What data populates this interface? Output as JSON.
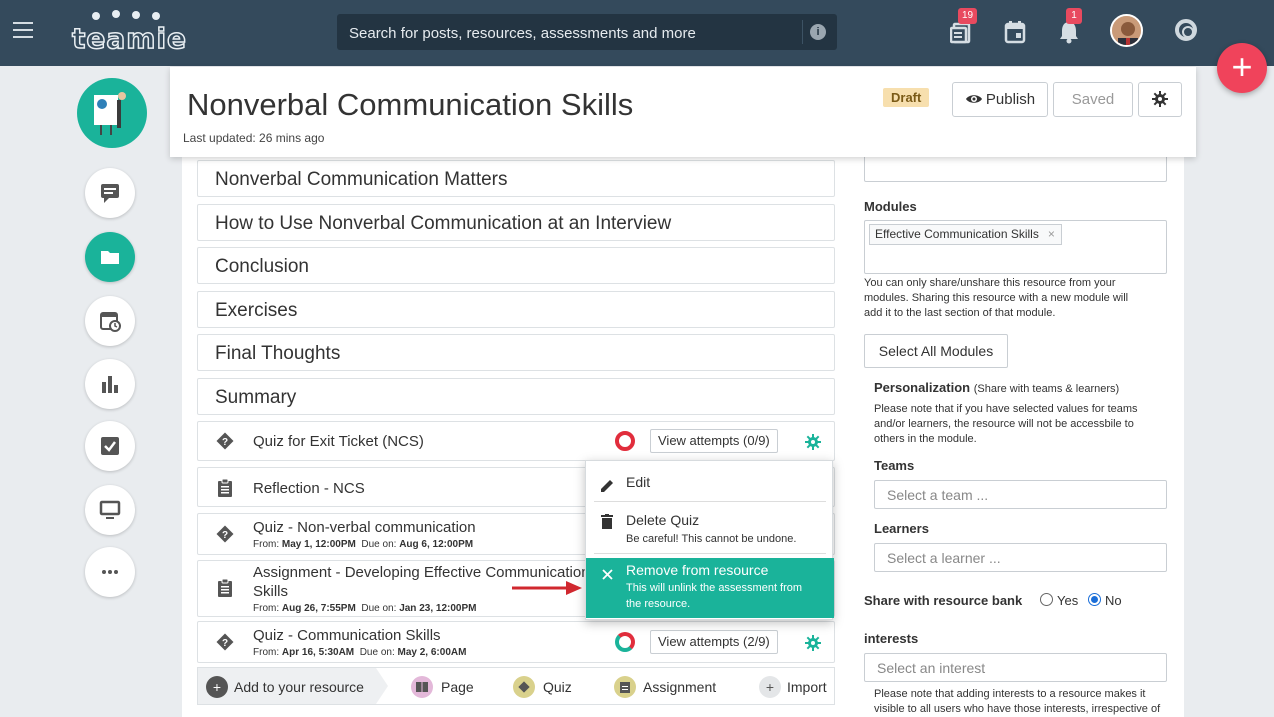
{
  "app": {
    "logo_text": "teamie",
    "search_placeholder": "Search for posts, resources, assessments and more",
    "search_info": "i",
    "badges": {
      "resources": "19",
      "notifications": "1"
    },
    "fab_label": "+"
  },
  "header": {
    "title": "Nonverbal Communication Skills",
    "last_updated": "Last updated: 26 mins ago",
    "status": "Draft",
    "publish_label": "Publish",
    "saved_label": "Saved"
  },
  "sections": [
    "Nonverbal Communication Matters",
    "How to Use Nonverbal Communication at an Interview",
    "Conclusion",
    "Exercises",
    "Final Thoughts",
    "Summary"
  ],
  "items": [
    {
      "type": "quiz",
      "name": "Quiz for Exit Ticket (NCS)",
      "attempts": "View attempts (0/9)"
    },
    {
      "type": "assignment",
      "name": "Reflection - NCS"
    },
    {
      "type": "quiz",
      "name": "Quiz - Non-verbal communication",
      "from_label": "From:",
      "from": "May 1, 12:00PM",
      "due_label": "Due on:",
      "due": "Aug 6, 12:00PM"
    },
    {
      "type": "assignment",
      "name_line1": "Assignment - Developing Effective Communication",
      "name_line2": "Skills",
      "from_label": "From:",
      "from": "Aug 26, 7:55PM",
      "due_label": "Due on:",
      "due": "Jan 23, 12:00PM"
    },
    {
      "type": "quiz",
      "name": "Quiz - Communication Skills",
      "from_label": "From:",
      "from": "Apr 16, 5:30AM",
      "due_label": "Due on:",
      "due": "May 2, 6:00AM",
      "attempts": "View attempts (2/9)"
    }
  ],
  "add_bar": {
    "add_label": "Add to your resource",
    "page": "Page",
    "quiz": "Quiz",
    "assignment": "Assignment",
    "import": "Import"
  },
  "menu": {
    "edit": "Edit",
    "delete": "Delete Quiz",
    "delete_sub": "Be careful! This cannot be undone.",
    "remove": "Remove from resource",
    "remove_sub_1": "This will unlink the assessment from",
    "remove_sub_2": "the resource."
  },
  "right": {
    "modules_label": "Modules",
    "module_chip": "Effective Communication Skills",
    "chip_remove": "×",
    "modules_note_1": "You can only share/unshare this resource from your",
    "modules_note_2": "modules. Sharing this resource with a new module will",
    "modules_note_3": "add it to the last section of that module.",
    "select_all": "Select All Modules",
    "personalization": "Personalization",
    "personalization_hint": "(Share with teams & learners)",
    "personalization_note_1": "Please note that if you have selected values for teams",
    "personalization_note_2": "and/or learners, the resource will not be accessbile to",
    "personalization_note_3": "others in the module.",
    "teams_label": "Teams",
    "teams_placeholder": "Select a team ...",
    "learners_label": "Learners",
    "learners_placeholder": "Select a learner ...",
    "share_bank_label": "Share with resource bank",
    "yes": "Yes",
    "no": "No",
    "share_bank_value": "No",
    "interests_label": "interests",
    "interests_placeholder": "Select an interest",
    "interests_note": "Please note that adding interests to a resource makes it",
    "interests_note_2": "visible to all users who have those interests, irrespective of"
  },
  "colors": {
    "topbar": "#344a5c",
    "accent": "#1ab39a",
    "fab": "#f0435b",
    "draft_bg": "#f7dfae",
    "arrow": "#d0282f"
  }
}
